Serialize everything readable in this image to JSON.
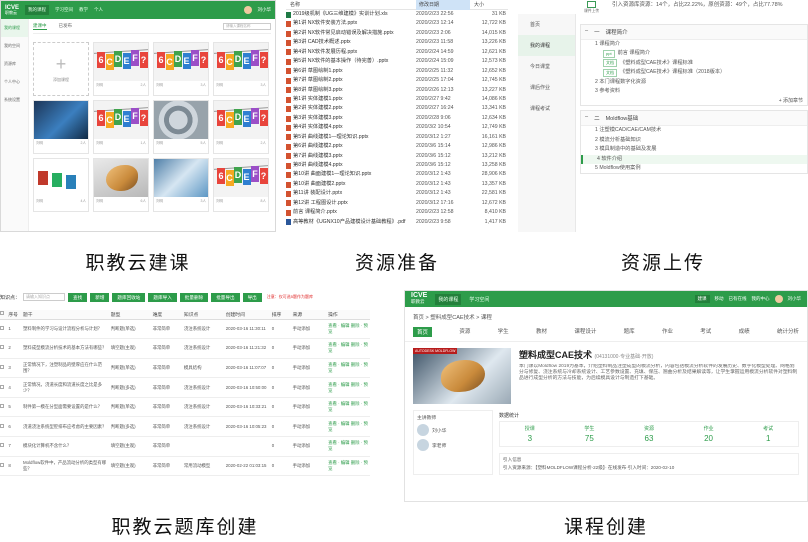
{
  "captions": {
    "p1": "职教云建课",
    "p2": "资源准备",
    "p3": "资源上传",
    "p4": "职教云题库创建",
    "p5": "课程创建"
  },
  "p1": {
    "logo": "ICVE",
    "logo_sub": "职教云",
    "nav": [
      "我的课程",
      "学习空间",
      "教学",
      "个人"
    ],
    "user": "刘小华",
    "side_items": [
      "我的课程",
      "我的空间",
      "资源库",
      "个人中心",
      "系统设置"
    ],
    "tabs": [
      "建课中",
      "已发布"
    ],
    "search_placeholder": "请输入课程名称",
    "add_label": "添加课程",
    "cards": [
      {
        "meta_left": "刘明",
        "meta_right": "2人"
      },
      {
        "meta_left": "刘明",
        "meta_right": "3人"
      },
      {
        "meta_left": "刘明",
        "meta_right": "3人"
      },
      {
        "meta_left": "刘明",
        "meta_right": "2人"
      },
      {
        "meta_left": "刘明",
        "meta_right": "1人"
      },
      {
        "meta_left": "刘明",
        "meta_right": "5人"
      },
      {
        "meta_left": "刘明",
        "meta_right": "2人"
      },
      {
        "meta_left": "刘明",
        "meta_right": "4人"
      },
      {
        "meta_left": "刘明",
        "meta_right": "6人"
      },
      {
        "meta_left": "刘明",
        "meta_right": "3人"
      },
      {
        "meta_left": "刘明",
        "meta_right": "8人"
      }
    ]
  },
  "p2": {
    "headers": {
      "name": "名称",
      "date": "修改日期",
      "size": "大小"
    },
    "files": [
      {
        "type": "xls",
        "name": "2019级机制《UG三维建模》实训计划.xls",
        "date": "2020/2/23 22:56",
        "size": "31 KB"
      },
      {
        "type": "ppt",
        "name": "第1讲 NX软件安装方法.pptx",
        "date": "2020/2/23 12:14",
        "size": "12,722 KB"
      },
      {
        "type": "ppt",
        "name": "第2讲 NX软件常见启动错误及解决措施.pptx",
        "date": "2020/2/23 2:06",
        "size": "14,015 KB"
      },
      {
        "type": "ppt",
        "name": "第3讲 CAD技术概述.pptx",
        "date": "2020/2/23 11:58",
        "size": "13,226 KB"
      },
      {
        "type": "ppt",
        "name": "第4讲 NX软件发展历程.pptx",
        "date": "2020/2/24 14:59",
        "size": "12,621 KB"
      },
      {
        "type": "ppt",
        "name": "第5讲 NX软件的基本操作（待完善）.pptx",
        "date": "2020/2/24 15:09",
        "size": "12,573 KB"
      },
      {
        "type": "ppt",
        "name": "第6讲 草图绘制1.pptx",
        "date": "2020/2/25 11:32",
        "size": "12,652 KB"
      },
      {
        "type": "ppt",
        "name": "第7讲 草图绘制2.pptx",
        "date": "2020/2/25 17:04",
        "size": "12,745 KB"
      },
      {
        "type": "ppt",
        "name": "第8讲 草图绘制3.pptx",
        "date": "2020/2/26 12:13",
        "size": "13,227 KB"
      },
      {
        "type": "ppt",
        "name": "第1讲 实体建模1.pptx",
        "date": "2020/2/27 9:42",
        "size": "14,086 KB"
      },
      {
        "type": "ppt",
        "name": "第2讲 实体建模2.pptx",
        "date": "2020/2/27 16:24",
        "size": "13,341 KB"
      },
      {
        "type": "ppt",
        "name": "第3讲 实体建模3.pptx",
        "date": "2020/2/28 9:06",
        "size": "12,634 KB"
      },
      {
        "type": "ppt",
        "name": "第4讲 实体建模4.pptx",
        "date": "2020/3/2 10:54",
        "size": "12,749 KB"
      },
      {
        "type": "ppt",
        "name": "第5讲 曲线建模1—理论知识.pptx",
        "date": "2020/3/12 1:27",
        "size": "16,161 KB"
      },
      {
        "type": "ppt",
        "name": "第6讲 曲线建模2.pptx",
        "date": "2020/3/6 15:14",
        "size": "12,986 KB"
      },
      {
        "type": "ppt",
        "name": "第7讲 曲线建模3.pptx",
        "date": "2020/3/6 15:12",
        "size": "13,212 KB"
      },
      {
        "type": "ppt",
        "name": "第8讲 曲线建模4.pptx",
        "date": "2020/3/6 15:12",
        "size": "13,258 KB"
      },
      {
        "type": "ppt",
        "name": "第10讲 曲面建模1—理论知识.pptx",
        "date": "2020/3/12 1:43",
        "size": "28,906 KB"
      },
      {
        "type": "ppt",
        "name": "第10讲 曲面建模2.pptx",
        "date": "2020/3/12 1:43",
        "size": "13,357 KB"
      },
      {
        "type": "ppt",
        "name": "第11讲 装配设计.pptx",
        "date": "2020/3/12 1:43",
        "size": "22,581 KB"
      },
      {
        "type": "ppt",
        "name": "第12讲 工程图设计.pptx",
        "date": "2020/3/12 17:16",
        "size": "12,672 KB"
      },
      {
        "type": "ppt",
        "name": "前言 课程简介.pptx",
        "date": "2020/2/23 12:58",
        "size": "8,410 KB"
      },
      {
        "type": "doc",
        "name": "高等教材《UGNX10产品建模设计基础教程》.pdf",
        "date": "2020/2/23 9:58",
        "size": "1,417 KB"
      }
    ]
  },
  "p3": {
    "stats_line": "引入资源库资源：14个，占比22.22%，原创资源：49个，占比77.78%",
    "upload_label": "课件上传",
    "side_items": [
      "首页",
      "我的课程",
      "今日课堂",
      "课后作业",
      "课程考试"
    ],
    "groups": [
      {
        "toggle": "–",
        "number": "一",
        "title": "课程简介",
        "items": [
          {
            "level": 1,
            "text": "1 课程简介",
            "tag": ""
          },
          {
            "level": 2,
            "text": "前言 课程简介",
            "tag": "ppt"
          },
          {
            "level": 2,
            "text": "《塑料成型CAE技术》课程标准",
            "tag": "文档"
          },
          {
            "level": 2,
            "text": "《塑料成型CAE技术》课程标准（2018版本）",
            "tag": "文档"
          },
          {
            "level": 1,
            "text": "2 本门课程数字化资源",
            "tag": ""
          },
          {
            "level": 1,
            "text": "3 参考资料",
            "tag": ""
          }
        ],
        "add_label": "+ 添加章节"
      },
      {
        "toggle": "–",
        "number": "二",
        "title": "Moldflow基础",
        "items": [
          {
            "level": 1,
            "text": "1 注塑模CAD/CAE/CAM技术",
            "tag": ""
          },
          {
            "level": 1,
            "text": "2 模流分析基础知识",
            "tag": ""
          },
          {
            "level": 1,
            "text": "3 模具制造中的基础及发展",
            "tag": ""
          },
          {
            "level": 1,
            "text": "4 软件介绍",
            "tag": ""
          },
          {
            "level": 1,
            "text": "5 Moldflow使用案例",
            "tag": ""
          }
        ],
        "add_label": ""
      }
    ]
  },
  "p4": {
    "search_label": "知识点：",
    "search_placeholder": "请输入知识点",
    "buttons": [
      "查找",
      "新增",
      "题库回收站",
      "题库导入",
      "批量删除",
      "批量导出",
      "导出"
    ],
    "note": "注意：仅可选5题作为题库",
    "headers": [
      "",
      "序号",
      "题干",
      "题型",
      "难度",
      "知识点",
      "创建时间",
      "排序",
      "来源",
      "操作"
    ],
    "rows": [
      {
        "no": "1",
        "stem": "塑料制件的学习与设计流程分析与计划？",
        "type": "判断题(单选)",
        "diff": "非常简单",
        "kp": "浇注系统设计",
        "time": "2020-03-16 11:30:11",
        "order": "0",
        "src": "手动添加",
        "ops": "查看 · 编辑 删除 · 预览"
      },
      {
        "no": "2",
        "stem": "塑料成型模流分析技术的基本方法有哪些？",
        "type": "填空题(主观)",
        "diff": "非常简单",
        "kp": "浇注系统设计",
        "time": "2020-03-16 11:21:32",
        "order": "0",
        "src": "手动添加",
        "ops": "查看 · 编辑 删除 · 预览"
      },
      {
        "no": "3",
        "stem": "正常情况下，注塑制品的壁厚应在什么范围？",
        "type": "判断题(单选)",
        "diff": "非常简单",
        "kp": "模具结构",
        "time": "2020-03-16 11:07:07",
        "order": "0",
        "src": "手动添加",
        "ops": "查看 · 编辑 删除 · 预览"
      },
      {
        "no": "4",
        "stem": "正常情况，浇道长度和流道长度之比是多少？",
        "type": "判断题(多选)",
        "diff": "非常简单",
        "kp": "浇注系统设计",
        "time": "2020-03-16 10:50:00",
        "order": "0",
        "src": "手动添加",
        "ops": "查看 · 编辑 删除 · 预览"
      },
      {
        "no": "5",
        "stem": "制件第一模在分型面需要设置的是什么？",
        "type": "判断题(单选)",
        "diff": "非常简单",
        "kp": "浇注系统设计",
        "time": "2020-03-16 10:33:21",
        "order": "0",
        "src": "手动添加",
        "ops": "查看 · 编辑 删除 · 预览"
      },
      {
        "no": "6",
        "stem": "浇道浇注系统型腔排布应考虑的主要因素？",
        "type": "判断题(多选)",
        "diff": "非常简单",
        "kp": "浇注系统设计",
        "time": "2020-03-16 10:05:23",
        "order": "0",
        "src": "手动添加",
        "ops": "查看 · 编辑 删除 · 预览"
      },
      {
        "no": "7",
        "stem": "模块化计算机不含什么？",
        "type": "填空题(主观)",
        "diff": "非常简单",
        "kp": "",
        "time": "",
        "order": "0",
        "src": "手动添加",
        "ops": "查看 · 编辑 删除 · 预览"
      },
      {
        "no": "8",
        "stem": "Moldflow软件中，产品流动分析的类型有哪些？",
        "type": "填空题(主观)",
        "diff": "非常简单",
        "kp": "常用流动模型",
        "time": "2020-02-22 01:03:15",
        "order": "0",
        "src": "手动添加",
        "ops": "查看 · 编辑 删除 · 预览"
      }
    ]
  },
  "p5": {
    "logo": "ICVE",
    "logo_sub": "职教云",
    "nav": [
      "我的课程",
      "学习空间"
    ],
    "right": [
      "建课",
      "移动",
      "已有在线",
      "我的中心"
    ],
    "user": "刘小华",
    "crumb": "首页 > 塑料成型CAE技术 > 课程",
    "tabs": [
      "首页",
      "资源",
      "学生",
      "教材",
      "课程设计",
      "题库",
      "作业",
      "考试",
      "成绩",
      "统计分析"
    ],
    "ribbon": "AUTODESK MOLDFLOW",
    "title": "塑料成型CAE技术",
    "title_code": "(04131000·专业基础·开放)",
    "desc": "本门课以Moldflow 2019为基本，介绍塑料制品注塑成型的模流分析，内容包括模流分析软件的发展历史、数字化模型处理、网格划分与修复、浇注系统与冷却系统设计、工艺参数设置、充填、保压、翘曲分析及结果解读等，让学生掌握运用模流分析软件对塑料制品进行成型分析的方法与技能，为后续模具设计与制造打下基础。",
    "teacher_title": "主讲教师",
    "teachers": [
      "刘小华",
      "李老师"
    ],
    "stats_title": "数据统计",
    "stats": [
      {
        "label": "授课",
        "value": "3"
      },
      {
        "label": "学生",
        "value": "75"
      },
      {
        "label": "资源",
        "value": "63"
      },
      {
        "label": "作业",
        "value": "20"
      },
      {
        "label": "考试",
        "value": "1"
      }
    ],
    "log_title": "引入信息",
    "log_text": "引入资源来源：【塑料MOLDFLOW课程分析-22级】· 在线发布·引入时间：2020-02-10"
  },
  "colors": {
    "brand_green": "#2d9c4a",
    "alert_red": "#e02a2a"
  }
}
